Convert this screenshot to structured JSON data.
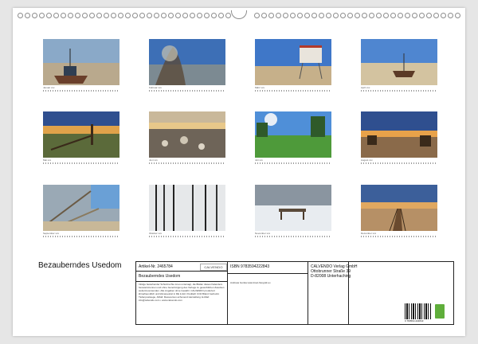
{
  "colors": {
    "accent": "#5fae3b",
    "frame": "#222222"
  },
  "calendar": {
    "title": "Bezauberndes Usedom"
  },
  "months": [
    {
      "caption": "Januar xxx",
      "scene": "boat-beach"
    },
    {
      "caption": "Februar xxx",
      "scene": "tree-lake"
    },
    {
      "caption": "März xxx",
      "scene": "lifeguard-tower"
    },
    {
      "caption": "April xxx",
      "scene": "boat-sand"
    },
    {
      "caption": "Mai xxx",
      "scene": "sunset-fence"
    },
    {
      "caption": "Juni xxx",
      "scene": "stones-shore"
    },
    {
      "caption": "Juli xxx",
      "scene": "green-field"
    },
    {
      "caption": "August xxx",
      "scene": "beach-chairs"
    },
    {
      "caption": "September xxx",
      "scene": "driftwood"
    },
    {
      "caption": "Oktober xxx",
      "scene": "reeds-ice"
    },
    {
      "caption": "November xxx",
      "scene": "snow-bench"
    },
    {
      "caption": "Dezember xxx",
      "scene": "boardwalk"
    }
  ],
  "info": {
    "article": "Artikel-Nr. 2465784",
    "logo": "CALVENDO",
    "product_title": "Bezauberndes Usedom",
    "blurb": "Infolge bestehender Schutzrechte ist es untersagt, die Blätter dieses Kalenders herauszutrennen und ohne Genehmigung des Verlags zu gewerblichen Zwecken weiterzuverwenden. Alle Angaben ohne Gewähr. CALVENDO produziert klimafreundlich und klimaneutral in DE & EU. Postfach CO2 Bilanz bedruckt. Tiefenpostwege, Abfall. Ressourcen-schonend Herstellung. E-Mail: info@calvendo.com • www.calvendo.com",
    "isbn": "ISBN 9783594222843",
    "publisher_lines": [
      "CALVENDO Verlag GmbH",
      "Ottobrunner Straße 39",
      "D-82008 Unterhaching"
    ],
    "author": "Andreas Gonka www.insel-fotograf.eu",
    "barcode_number": "9 783594 222843"
  }
}
